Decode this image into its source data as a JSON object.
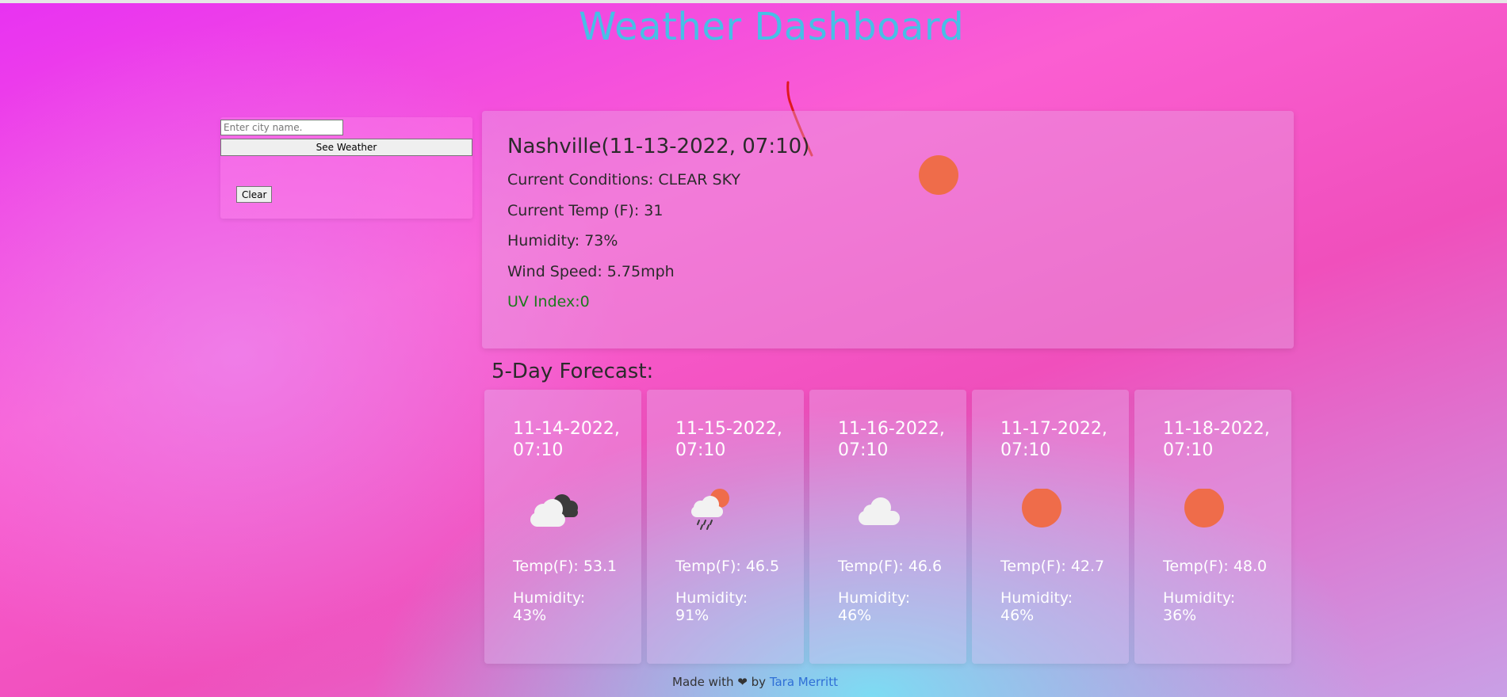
{
  "page": {
    "title": "Weather Dashboard"
  },
  "search": {
    "placeholder": "Enter city name.",
    "value": "",
    "submit_label": "See Weather",
    "clear_label": "Clear"
  },
  "current": {
    "heading": "Nashville(11-13-2022, 07:10)",
    "conditions": "Current Conditions: CLEAR SKY",
    "temp": "Current Temp (F): 31",
    "humidity": "Humidity: 73%",
    "wind": "Wind Speed: 5.75mph",
    "uv": "UV Index:0",
    "icon": "clear-sky-sun-icon",
    "colors": {
      "uv": "#1d7a1d",
      "sun": "#ef6c4a"
    }
  },
  "forecast": {
    "title": "5-Day Forecast:",
    "days": [
      {
        "date": "11-14-2022, 07:10",
        "icon": "dark-clouds-icon",
        "temp": "Temp(F): 53.1",
        "humidity": "Humidity: 43%"
      },
      {
        "date": "11-15-2022, 07:10",
        "icon": "rain-sun-cloud-icon",
        "temp": "Temp(F): 46.5",
        "humidity": "Humidity: 91%"
      },
      {
        "date": "11-16-2022, 07:10",
        "icon": "cloud-icon",
        "temp": "Temp(F): 46.6",
        "humidity": "Humidity: 46%"
      },
      {
        "date": "11-17-2022, 07:10",
        "icon": "sun-icon",
        "temp": "Temp(F): 42.7",
        "humidity": "Humidity: 46%"
      },
      {
        "date": "11-18-2022, 07:10",
        "icon": "sun-icon",
        "temp": "Temp(F): 48.0",
        "humidity": "Humidity: 36%"
      }
    ]
  },
  "footer": {
    "prefix": "Made with",
    "heart": "❤",
    "by": "by",
    "author": "Tara Merritt",
    "icon": "heart-icon"
  },
  "colors": {
    "title": "#47bfe6",
    "link": "#2f6fd6"
  }
}
